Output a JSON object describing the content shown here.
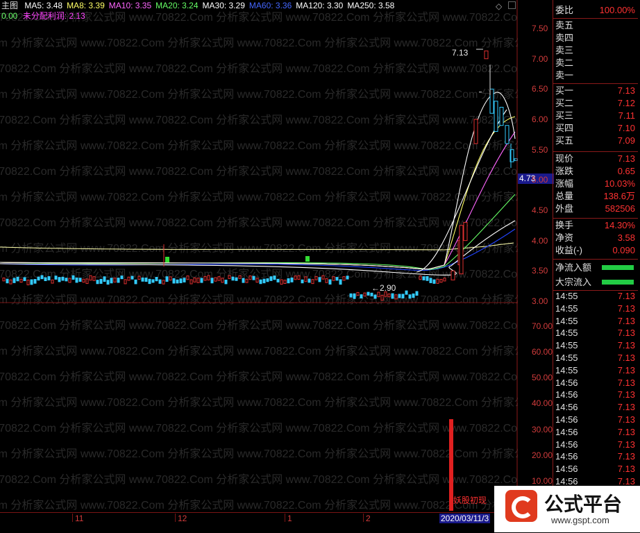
{
  "toolbar": {
    "main_label": "主图",
    "ma": [
      {
        "label": "MA5: 3.48",
        "color": "#ffffff"
      },
      {
        "label": "MA8: 3.39",
        "color": "#ffff66"
      },
      {
        "label": "MA10: 3.35",
        "color": "#ff66ff"
      },
      {
        "label": "MA20: 3.24",
        "color": "#66ff66"
      },
      {
        "label": "MA30: 3.29",
        "color": "#ffffff"
      },
      {
        "label": "MA60: 3.36",
        "color": "#4466ff"
      },
      {
        "label": "MA120: 3.30",
        "color": "#ffffff"
      },
      {
        "label": "MA250: 3.58",
        "color": "#ffffff"
      }
    ],
    "sub_left": "0.00",
    "sub_label": "未分配利润: 2.13",
    "sub_color": "#ff44ff"
  },
  "chart_annotations": {
    "high_label": "7.13",
    "low_label": "←2.90",
    "current_marker": "4.73",
    "signal_text": "妖股初现"
  },
  "price_axis": [
    "7.50",
    "7.00",
    "6.50",
    "6.00",
    "5.50",
    "5.00",
    "4.50",
    "4.00",
    "3.50",
    "3.00"
  ],
  "vol_axis": [
    "70.00",
    "60.00",
    "50.00",
    "40.00",
    "30.00",
    "20.00",
    "10.00"
  ],
  "x_axis": {
    "labels": [
      "11",
      "12",
      "1",
      "2"
    ],
    "date": "2020/03/11/3"
  },
  "quote_panel": {
    "wei_bi": {
      "k": "委比",
      "v": "100.00%"
    },
    "sell": [
      {
        "k": "卖五",
        "v": ""
      },
      {
        "k": "卖四",
        "v": ""
      },
      {
        "k": "卖三",
        "v": ""
      },
      {
        "k": "卖二",
        "v": ""
      },
      {
        "k": "卖一",
        "v": ""
      }
    ],
    "buy": [
      {
        "k": "买一",
        "v": "7.13"
      },
      {
        "k": "买二",
        "v": "7.12"
      },
      {
        "k": "买三",
        "v": "7.11"
      },
      {
        "k": "买四",
        "v": "7.10"
      },
      {
        "k": "买五",
        "v": "7.09"
      }
    ],
    "stats": [
      {
        "k": "现价",
        "v": "7.13"
      },
      {
        "k": "涨跌",
        "v": "0.65"
      },
      {
        "k": "涨幅",
        "v": "10.03%"
      },
      {
        "k": "总量",
        "v": "138.6万"
      },
      {
        "k": "外盘",
        "v": "582506"
      }
    ],
    "stats2": [
      {
        "k": "换手",
        "v": "14.30%"
      },
      {
        "k": "净资",
        "v": "3.58"
      },
      {
        "k": "收益(-)",
        "v": "0.090"
      }
    ],
    "flow": [
      {
        "k": "净流入额"
      },
      {
        "k": "大宗流入"
      }
    ],
    "ticks": [
      {
        "t": "14:55",
        "p": "7.13"
      },
      {
        "t": "14:55",
        "p": "7.13"
      },
      {
        "t": "14:55",
        "p": "7.13"
      },
      {
        "t": "14:55",
        "p": "7.13"
      },
      {
        "t": "14:55",
        "p": "7.13"
      },
      {
        "t": "14:55",
        "p": "7.13"
      },
      {
        "t": "14:55",
        "p": "7.13"
      },
      {
        "t": "14:56",
        "p": "7.13"
      },
      {
        "t": "14:56",
        "p": "7.13"
      },
      {
        "t": "14:56",
        "p": "7.13"
      },
      {
        "t": "14:56",
        "p": "7.13"
      },
      {
        "t": "14:56",
        "p": "7.13"
      },
      {
        "t": "14:56",
        "p": "7.13"
      },
      {
        "t": "14:56",
        "p": "7.13"
      },
      {
        "t": "14:56",
        "p": "7.13"
      },
      {
        "t": "14:56",
        "p": "7.13"
      }
    ]
  },
  "watermark": {
    "text": "www.70822.Com 分析家公式网",
    "logo_text": "公式平台",
    "logo_url": "www.gspt.com",
    "center_mark": "gspt.com"
  }
}
